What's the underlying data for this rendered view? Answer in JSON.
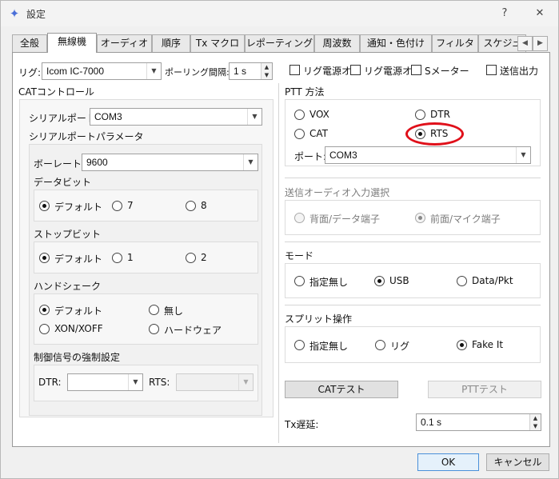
{
  "window": {
    "title": "設定",
    "help": "?",
    "close": "✕"
  },
  "tabs": [
    "全般",
    "無線機",
    "オーディオ",
    "順序",
    "Tx マクロ",
    "レポーティング",
    "周波数",
    "通知・色付け",
    "フィルタ",
    "スケジュー"
  ],
  "active_tab": "無線機",
  "tab_arrows": {
    "left": "◀",
    "right": "▶"
  },
  "top": {
    "rig_label": "リグ:",
    "rig_value": "Icom IC-7000",
    "polling_label": "ポーリング間隔:",
    "polling_value": "1 s",
    "rig_power_on": "リグ電源オ",
    "rig_power_off": "リグ電源オ",
    "s_meter": "Sメーター",
    "tx_power": "送信出力"
  },
  "cat": {
    "title": "CATコントロール",
    "serial_port_label": "シリアルポート:",
    "serial_port_value": "COM3",
    "params_title": "シリアルポートパラメータ",
    "baud_label": "ボーレート:",
    "baud_value": "9600",
    "data_bits_title": "データビット",
    "data_bits": [
      "デフォルト",
      "7",
      "8"
    ],
    "stop_bits_title": "ストップビット",
    "stop_bits": [
      "デフォルト",
      "1",
      "2"
    ],
    "handshake_title": "ハンドシェーク",
    "handshake": [
      "デフォルト",
      "無し",
      "XON/XOFF",
      "ハードウェア"
    ],
    "force_title": "制御信号の強制設定",
    "dtr_label": "DTR:",
    "rts_label": "RTS:"
  },
  "ptt": {
    "title": "PTT 方法",
    "options": [
      "VOX",
      "DTR",
      "CAT",
      "RTS"
    ],
    "selected": "RTS",
    "port_label": "ポート:",
    "port_value": "COM3",
    "highlight_color": "#e0101a"
  },
  "audio_input": {
    "title": "送信オーディオ入力選択",
    "options": [
      "背面/データ端子",
      "前面/マイク端子"
    ]
  },
  "mode": {
    "title": "モード",
    "options": [
      "指定無し",
      "USB",
      "Data/Pkt"
    ]
  },
  "split": {
    "title": "スプリット操作",
    "options": [
      "指定無し",
      "リグ",
      "Fake It"
    ]
  },
  "buttons": {
    "cat_test": "CATテスト",
    "ptt_test": "PTTテスト",
    "ok": "OK",
    "cancel": "キャンセル"
  },
  "tx_delay": {
    "label": "Tx遅延:",
    "value": "0.1 s"
  },
  "icons": {
    "app": "star-compass-icon",
    "combo": "▼",
    "spin_up": "▲",
    "spin_down": "▼"
  }
}
